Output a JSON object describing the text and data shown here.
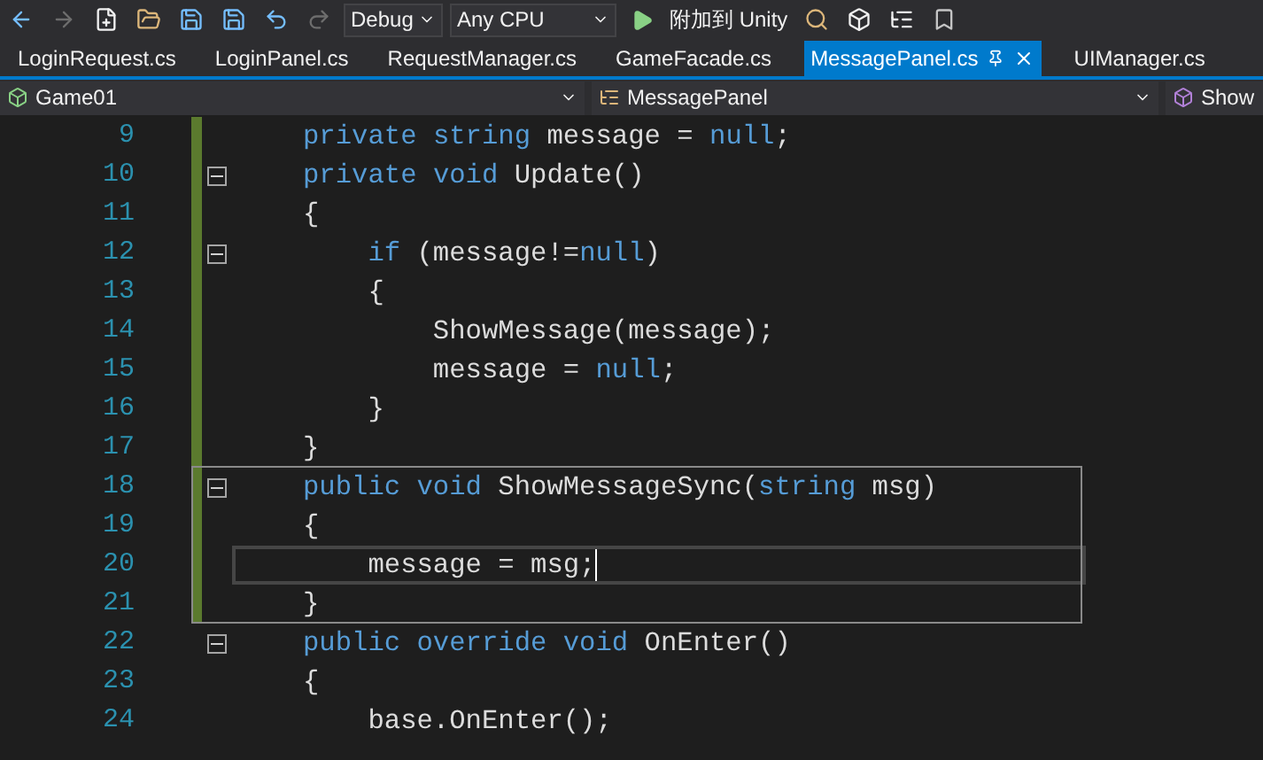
{
  "toolbar": {
    "configuration": "Debug",
    "platform": "Any CPU",
    "run_label": "附加到 Unity"
  },
  "tabs": [
    {
      "label": "LoginRequest.cs",
      "selected": false
    },
    {
      "label": "LoginPanel.cs",
      "selected": false
    },
    {
      "label": "RequestManager.cs",
      "selected": false
    },
    {
      "label": "GameFacade.cs",
      "selected": false
    },
    {
      "label": "MessagePanel.cs",
      "selected": true
    },
    {
      "label": "UIManager.cs",
      "selected": false
    }
  ],
  "navigation": {
    "project": "Game01",
    "type": "MessagePanel",
    "member": "Show"
  },
  "editor": {
    "lines": [
      {
        "number": "9",
        "changed": true,
        "fold": false,
        "current": false,
        "tokens": [
          {
            "text": "private",
            "kind": "keyword"
          },
          {
            "text": " string",
            "kind": "keyword"
          },
          {
            "text": " message = ",
            "kind": "identifier"
          },
          {
            "text": "null",
            "kind": "keyword"
          },
          {
            "text": ";",
            "kind": "identifier"
          }
        ]
      },
      {
        "number": "10",
        "changed": true,
        "fold": true,
        "current": false,
        "tokens": [
          {
            "text": "private",
            "kind": "keyword"
          },
          {
            "text": " void",
            "kind": "keyword"
          },
          {
            "text": " Update()",
            "kind": "identifier"
          }
        ]
      },
      {
        "number": "11",
        "changed": true,
        "fold": false,
        "current": false,
        "tokens": [
          {
            "text": "{",
            "kind": "identifier"
          }
        ]
      },
      {
        "number": "12",
        "changed": true,
        "fold": true,
        "current": false,
        "tokens": [
          {
            "text": "    if",
            "kind": "keyword"
          },
          {
            "text": " (message!=",
            "kind": "identifier"
          },
          {
            "text": "null",
            "kind": "keyword"
          },
          {
            "text": ")",
            "kind": "identifier"
          }
        ]
      },
      {
        "number": "13",
        "changed": true,
        "fold": false,
        "current": false,
        "tokens": [
          {
            "text": "    {",
            "kind": "identifier"
          }
        ]
      },
      {
        "number": "14",
        "changed": true,
        "fold": false,
        "current": false,
        "tokens": [
          {
            "text": "        ShowMessage(message);",
            "kind": "identifier"
          }
        ]
      },
      {
        "number": "15",
        "changed": true,
        "fold": false,
        "current": false,
        "tokens": [
          {
            "text": "        message = ",
            "kind": "identifier"
          },
          {
            "text": "null",
            "kind": "keyword"
          },
          {
            "text": ";",
            "kind": "identifier"
          }
        ]
      },
      {
        "number": "16",
        "changed": true,
        "fold": false,
        "current": false,
        "tokens": [
          {
            "text": "    }",
            "kind": "identifier"
          }
        ]
      },
      {
        "number": "17",
        "changed": true,
        "fold": false,
        "current": false,
        "tokens": [
          {
            "text": "}",
            "kind": "identifier"
          }
        ]
      },
      {
        "number": "18",
        "changed": true,
        "fold": true,
        "current": false,
        "tokens": [
          {
            "text": "public",
            "kind": "keyword"
          },
          {
            "text": " void",
            "kind": "keyword"
          },
          {
            "text": " ShowMessageSync(",
            "kind": "identifier"
          },
          {
            "text": "string",
            "kind": "keyword"
          },
          {
            "text": " msg)",
            "kind": "identifier"
          }
        ]
      },
      {
        "number": "19",
        "changed": true,
        "fold": false,
        "current": false,
        "tokens": [
          {
            "text": "{",
            "kind": "identifier"
          }
        ]
      },
      {
        "number": "20",
        "changed": true,
        "fold": false,
        "current": true,
        "tokens": [
          {
            "text": "    message = msg;",
            "kind": "identifier"
          }
        ]
      },
      {
        "number": "21",
        "changed": true,
        "fold": false,
        "current": false,
        "tokens": [
          {
            "text": "}",
            "kind": "identifier"
          }
        ]
      },
      {
        "number": "22",
        "changed": false,
        "fold": true,
        "current": false,
        "tokens": [
          {
            "text": "public",
            "kind": "keyword"
          },
          {
            "text": " override",
            "kind": "keyword"
          },
          {
            "text": " void",
            "kind": "keyword"
          },
          {
            "text": " OnEnter()",
            "kind": "identifier"
          }
        ]
      },
      {
        "number": "23",
        "changed": false,
        "fold": false,
        "current": false,
        "tokens": [
          {
            "text": "{",
            "kind": "identifier"
          }
        ]
      },
      {
        "number": "24",
        "changed": false,
        "fold": false,
        "current": false,
        "tokens": [
          {
            "text": "    base.OnEnter();",
            "kind": "identifier"
          }
        ]
      }
    ]
  }
}
